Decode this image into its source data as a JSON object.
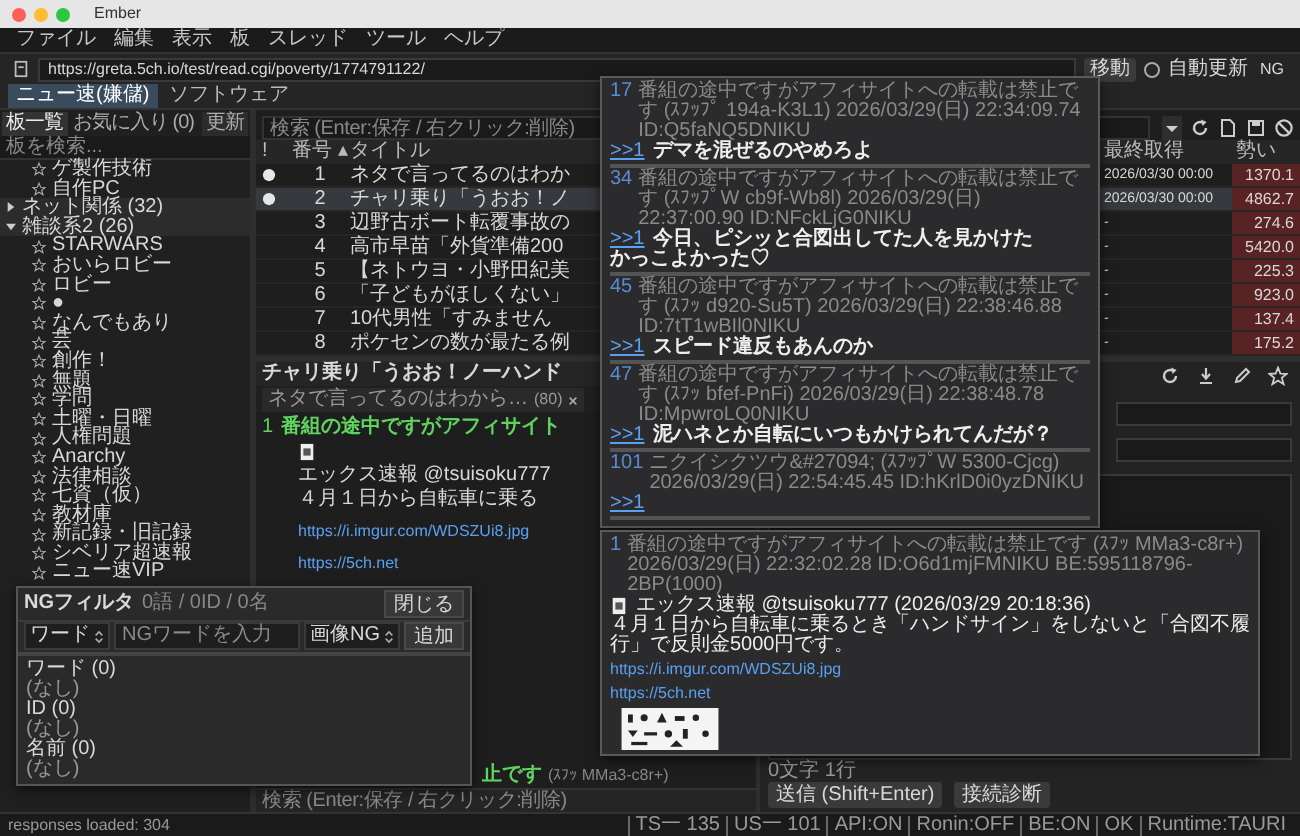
{
  "window": {
    "title": "Ember"
  },
  "menu": [
    "ファイル",
    "編集",
    "表示",
    "板",
    "スレッド",
    "ツール",
    "ヘルプ"
  ],
  "address_bar": {
    "url": "https://greta.5ch.io/test/read.cgi/poverty/1774791122/",
    "go_button": "移動",
    "auto_refresh": {
      "label": "自動更新",
      "checked": false
    },
    "ng_button": "NG"
  },
  "board_tabs": [
    {
      "label": "ニュー速(嫌儲)",
      "selected": true
    },
    {
      "label": "ソフトウェア",
      "selected": false
    }
  ],
  "sidebar": {
    "tabs": [
      {
        "label": "板一覧",
        "selected": true
      },
      {
        "label": "お気に入り (0)",
        "selected": false
      }
    ],
    "refresh_button": "更新",
    "search": {
      "placeholder": "板を検索..."
    },
    "items": [
      {
        "kind": "board",
        "label": "ゲ製作技術"
      },
      {
        "kind": "board",
        "label": "自作PC"
      },
      {
        "kind": "category",
        "label": "ネット関係 (32)",
        "expanded": false
      },
      {
        "kind": "category",
        "label": "雑談系2 (26)",
        "expanded": true,
        "children": [
          {
            "kind": "board",
            "label": "STARWARS"
          },
          {
            "kind": "board",
            "label": "おいらロビー"
          },
          {
            "kind": "board",
            "label": "ロビー"
          },
          {
            "kind": "board",
            "label": "●"
          },
          {
            "kind": "board",
            "label": "なんでもあり"
          },
          {
            "kind": "board",
            "label": "芸"
          },
          {
            "kind": "board",
            "label": "創作！"
          },
          {
            "kind": "board",
            "label": "無題"
          },
          {
            "kind": "board",
            "label": "学問"
          },
          {
            "kind": "board",
            "label": "土曜・日曜"
          },
          {
            "kind": "board",
            "label": "人権問題"
          },
          {
            "kind": "board",
            "label": "Anarchy"
          },
          {
            "kind": "board",
            "label": "法律相談"
          },
          {
            "kind": "board",
            "label": "七資（仮）"
          },
          {
            "kind": "board",
            "label": "教材庫"
          },
          {
            "kind": "board",
            "label": "新記録・旧記録"
          },
          {
            "kind": "board",
            "label": "シベリア超速報"
          },
          {
            "kind": "board",
            "label": "ニュー速VIP"
          }
        ]
      }
    ]
  },
  "thread_list": {
    "search": {
      "placeholder": "検索 (Enter:保存 / 右クリック:削除)"
    },
    "columns": [
      "!",
      "番号 ▴",
      "タイトル",
      "最終取得",
      "勢い"
    ],
    "rows": [
      {
        "has_new": true,
        "selected": false,
        "number": "1",
        "title": "ネタで言ってるのはわか",
        "last_fetched": "2026/03/30 00:00",
        "momentum": "1370.1"
      },
      {
        "has_new": true,
        "selected": true,
        "number": "2",
        "title": "チャリ乗り「うおお！ノ",
        "last_fetched": "2026/03/30 00:00",
        "momentum": "4862.7"
      },
      {
        "has_new": false,
        "selected": false,
        "number": "3",
        "title": "辺野古ボート転覆事故の",
        "last_fetched": "-",
        "momentum": "274.6"
      },
      {
        "has_new": false,
        "selected": false,
        "number": "4",
        "title": "高市早苗「外貨準備200",
        "last_fetched": "-",
        "momentum": "5420.0"
      },
      {
        "has_new": false,
        "selected": false,
        "number": "5",
        "title": "【ネトウヨ・小野田紀美",
        "last_fetched": "-",
        "momentum": "225.3"
      },
      {
        "has_new": false,
        "selected": false,
        "number": "6",
        "title": "「子どもがほしくない」",
        "last_fetched": "-",
        "momentum": "923.0"
      },
      {
        "has_new": false,
        "selected": false,
        "number": "7",
        "title": "10代男性「すみません",
        "last_fetched": "-",
        "momentum": "137.4"
      },
      {
        "has_new": false,
        "selected": false,
        "number": "8",
        "title": "ポケセンの数が最たる例",
        "last_fetched": "-",
        "momentum": "175.2"
      }
    ]
  },
  "thread_view": {
    "title": "チャリ乗り「うおお！ノーハンド",
    "tabs": [
      {
        "label": "ネタで言ってるのはわから…",
        "count": "(80)",
        "selected": false
      }
    ],
    "post": {
      "number": "1",
      "name": "番組の途中ですがアフィサイト",
      "author": "エックス速報 @tsuisoku777",
      "body": "４月１日から自転車に乗る",
      "links": [
        "https://i.imgur.com/WDSZUi8.jpg",
        "https://5ch.net"
      ]
    },
    "partial_post": {
      "name": "止です",
      "id": "(ｽﾌｯ MMa3-c8r+)"
    },
    "search": {
      "placeholder": "検索 (Enter:保存 / 右クリック:削除)"
    }
  },
  "compose": {
    "counter": "0文字 1行",
    "send_button": "送信 (Shift+Enter)",
    "diagnose_button": "接続診断"
  },
  "status_bar": {
    "left": "responses loaded: 304",
    "items": [
      "TS一 135",
      "US一 101",
      "API:ON",
      "Ronin:OFF",
      "BE:ON",
      "OK",
      "Runtime:TAURI"
    ]
  },
  "reply_popup": {
    "posts": [
      {
        "number": "17",
        "header": "番組の途中ですがアフィサイトへの転載は禁止です (ｽﾌｯﾌﾟ 194a-K3L1) 2026/03/29(日) 22:34:09.74 ID:Q5faNQ5DNIKU",
        "anchor": ">>1",
        "lines": [
          "デマを混ぜるのやめろよ"
        ]
      },
      {
        "number": "34",
        "header": "番組の途中ですがアフィサイトへの転載は禁止です (ｽﾌｯﾌﾟW cb9f-Wb8l) 2026/03/29(日) 22:37:00.90 ID:NFckLjG0NIKU",
        "anchor": ">>1",
        "lines": [
          "今日、ピシッと合図出してた人を見かけた",
          "かっこよかった♡"
        ]
      },
      {
        "number": "45",
        "header": "番組の途中ですがアフィサイトへの転載は禁止です (ｽﾌｯ d920-Su5T) 2026/03/29(日) 22:38:46.88 ID:7tT1wBIl0NIKU",
        "anchor": ">>1",
        "lines": [
          "スピード違反もあんのか"
        ]
      },
      {
        "number": "47",
        "header": "番組の途中ですがアフィサイトへの転載は禁止です (ｽﾌｯ bfef-PnFi) 2026/03/29(日) 22:38:48.78 ID:MpwroLQ0NIKU",
        "anchor": ">>1",
        "lines": [
          "泥ハネとか自転にいつもかけられてんだが？"
        ]
      },
      {
        "number": "101",
        "header": "ニクイシクツウ&#27094; (ｽﾌｯﾌﾟW 5300-Cjcg) 2026/03/29(日) 22:54:45.45 ID:hKrlD0i0yzDNIKU",
        "anchor": ">>1"
      }
    ]
  },
  "post_popup": {
    "number": "1",
    "header": "番組の途中ですがアフィサイトへの転載は禁止です (ｽﾌｯ MMa3-c8r+) 2026/03/29(日) 22:32:02.28 ID:O6d1mjFMNIKU BE:595118796-2BP(1000)",
    "author": "エックス速報 @tsuisoku777 (2026/03/29 20:18:36)",
    "body": "４月１日から自転車に乗るとき「ハンドサイン」をしないと「合図不履行」で反則金5000円です。",
    "links": [
      "https://i.imgur.com/WDSZUi8.jpg",
      "https://5ch.net"
    ],
    "image": {
      "kind": "picture"
    }
  },
  "ng_filter": {
    "title": "NGフィルタ",
    "summary": "0語 / 0ID / 0名",
    "close_button": "閉じる",
    "type_select": "ワード",
    "input": {
      "placeholder": "NGワードを入力"
    },
    "mode_select": "画像NG",
    "add_button": "追加",
    "sections": [
      {
        "title": "ワード (0)",
        "empty_text": "(なし)"
      },
      {
        "title": "ID (0)",
        "empty_text": "(なし)"
      },
      {
        "title": "名前 (0)",
        "empty_text": "(なし)"
      }
    ]
  }
}
